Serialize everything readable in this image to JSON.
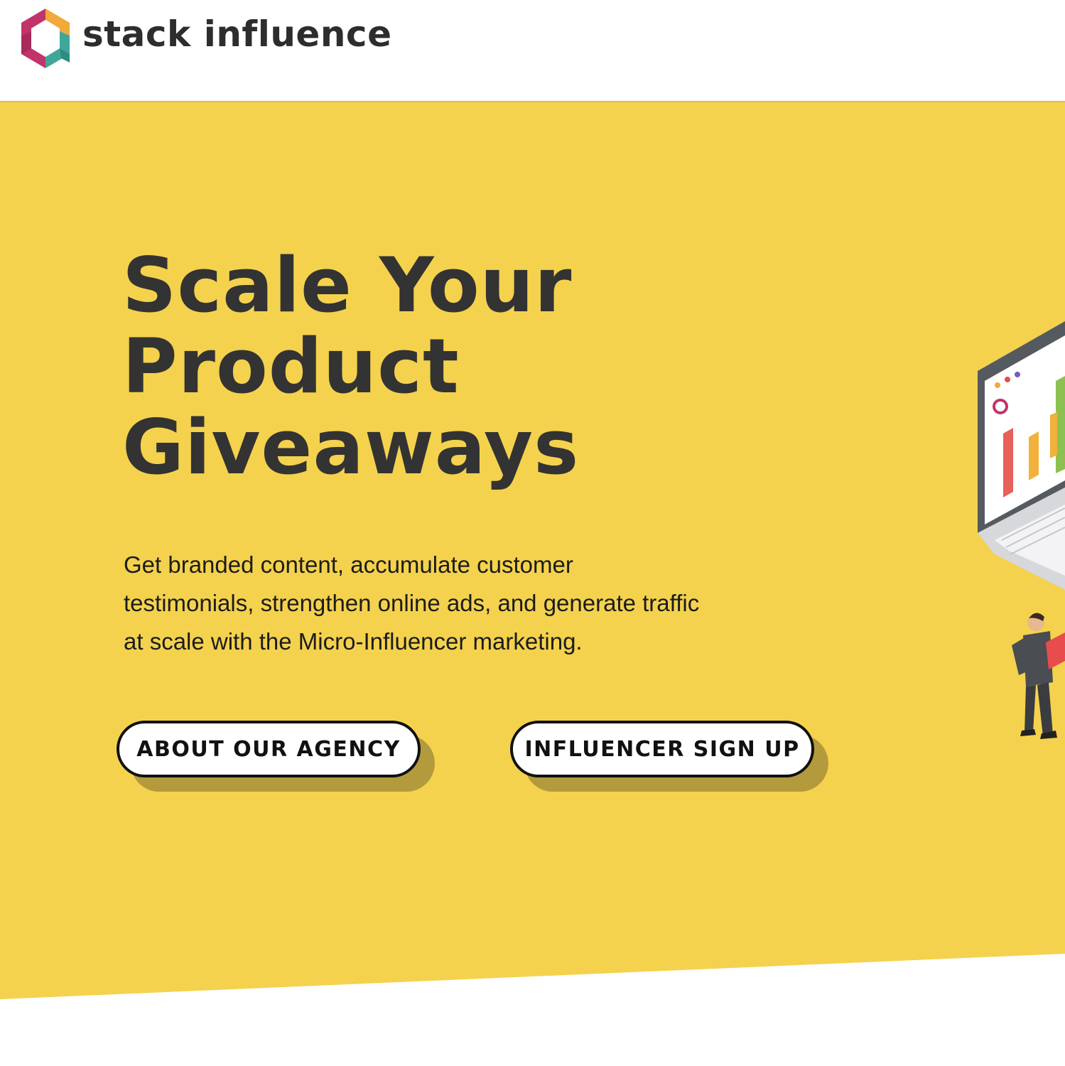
{
  "brand": {
    "name": "stack influence",
    "logo_icon": "hexagon-logo-icon"
  },
  "hero": {
    "headline": [
      "Scale Your",
      "Product",
      "Giveaways"
    ],
    "subtitle": "Get branded content, accumulate customer testimonials, strengthen online ads, and generate traffic at scale with the Micro-Influencer marketing.",
    "buttons": {
      "agency": "ABOUT OUR AGENCY",
      "influencer": "INFLUENCER SIGN UP"
    },
    "illustration": "laptop-analytics-illustration"
  },
  "colors": {
    "hero_background": "#f4d24d",
    "text_dark": "#333333",
    "button_shadow": "#b39b3d",
    "button_bg": "#ffffff",
    "logo_pink": "#c2336a",
    "logo_orange": "#f1a93b",
    "logo_teal": "#3fa79a"
  }
}
